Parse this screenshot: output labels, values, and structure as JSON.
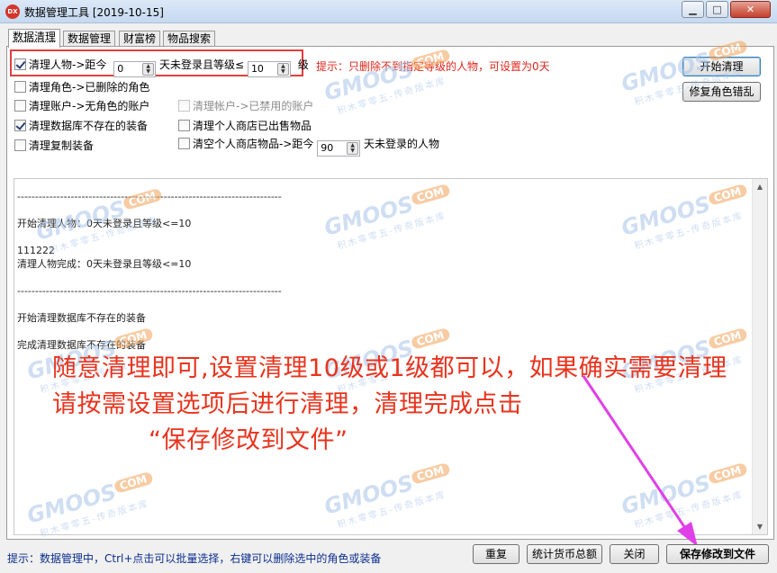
{
  "window": {
    "title": "数据管理工具 [2019-10-15]",
    "icon_label": "DX",
    "minimize_label": "▁",
    "maximize_label": "□",
    "close_label": "✕"
  },
  "tabs": [
    {
      "label": "数据清理",
      "active": true
    },
    {
      "label": "数据管理",
      "active": false
    },
    {
      "label": "财富榜",
      "active": false
    },
    {
      "label": "物品搜索",
      "active": false
    }
  ],
  "options": {
    "clear_players": {
      "label": "清理人物->距今",
      "checked": true,
      "days": "0",
      "unit": "天未登录且等级≤",
      "level": "10",
      "level_unit": "级"
    },
    "hint": "提示：只删除不到指定等级的人物，可设置为0天",
    "clear_roles": {
      "label": "清理角色->已删除的角色",
      "checked": false
    },
    "clear_accounts_no_role": {
      "label": "清理账户->无角色的账户",
      "checked": false
    },
    "clear_accounts_banned": {
      "label": "清理帐户->已禁用的账户",
      "checked": false,
      "disabled": true
    },
    "clear_missing_equipment": {
      "label": "清理数据库不存在的装备",
      "checked": true
    },
    "clear_shop_sold": {
      "label": "清理个人商店已出售物品",
      "checked": false
    },
    "clear_duplicate_equipment": {
      "label": "清理复制装备",
      "checked": false
    },
    "empty_shop_items": {
      "label": "清空个人商店物品->距今",
      "checked": false,
      "days": "90",
      "unit": "天未登录的人物"
    }
  },
  "buttons": {
    "start_clean": "开始清理",
    "repair_roles": "修复角色错乱",
    "reset": "重复",
    "stats_currency": "统计货币总额",
    "close": "关闭",
    "save_to_file": "保存修改到文件"
  },
  "log_lines": [
    "--------------------------------------------------------------------------",
    "",
    "开始清理人物：0天未登录且等级<=10",
    "",
    "111222",
    "清理人物完成：0天未登录且等级<=10",
    "",
    "--------------------------------------------------------------------------",
    "",
    "开始清理数据库不存在的装备",
    "",
    "完成清理数据库不存在的装备"
  ],
  "scroll": {
    "up": "▲",
    "down": "▼"
  },
  "annotation": {
    "line1": "随意清理即可,设置清理10级或1级都可以，如果确实需要清理",
    "line2": "请按需设置选项后进行清理，清理完成点击",
    "line3": "“保存修改到文件”",
    "arrow_color": "#e040e8"
  },
  "watermark": {
    "brand": "GMOOS",
    "badge": "COM",
    "sub": "积木零零五-传奇版本库"
  },
  "status_text": "提示：数据管理中，Ctrl+点击可以批量选择，右键可以删除选中的角色或装备"
}
